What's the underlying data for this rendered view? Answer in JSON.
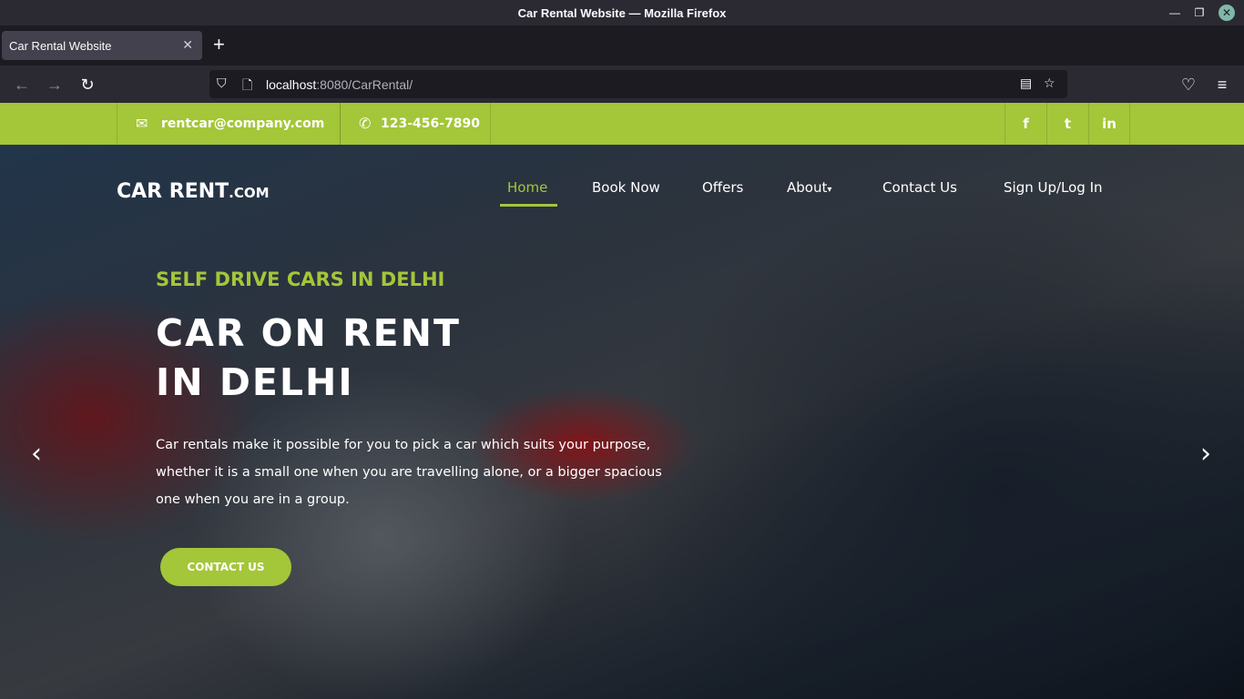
{
  "window": {
    "title": "Car Rental Website — Mozilla Firefox",
    "minimize": "—",
    "restore": "❐",
    "close": "✕"
  },
  "tabs": [
    {
      "label": "Car Rental Website",
      "close": "✕"
    }
  ],
  "new_tab": "+",
  "nav": {
    "back": "←",
    "forward": "→",
    "reload": "↻",
    "url_host": "localhost",
    "url_rest": ":8080/CarRental/",
    "shield": "⛉",
    "page_icon": "🗋",
    "reader": "▤",
    "bookmark": "☆",
    "pocket": "♡",
    "menu": "≡"
  },
  "topbar": {
    "email_icon": "✉",
    "email": "rentcar@company.com",
    "phone_icon": "✆",
    "phone": "123-456-7890",
    "social": [
      "f",
      "t",
      "in"
    ]
  },
  "brand": {
    "main": "CAR RENT",
    "suffix": ".COM"
  },
  "menu": {
    "home": "Home",
    "book": "Book Now",
    "offers": "Offers",
    "about": "About",
    "about_caret": "▾",
    "contact": "Contact Us",
    "signup": "Sign Up/Log In"
  },
  "hero": {
    "kicker": "SELF DRIVE CARS IN DELHI",
    "headline_1": "CAR ON RENT",
    "headline_2": "IN DELHI",
    "description": "Car rentals make it possible for you to pick a car which suits your purpose, whether it is a small one when you are travelling alone, or a bigger spacious one when you are in a group.",
    "cta": "CONTACT US",
    "prev": "‹",
    "next": "›"
  },
  "colors": {
    "accent": "#a4c639",
    "chrome_dark": "#1c1b22",
    "chrome": "#2b2a33"
  }
}
